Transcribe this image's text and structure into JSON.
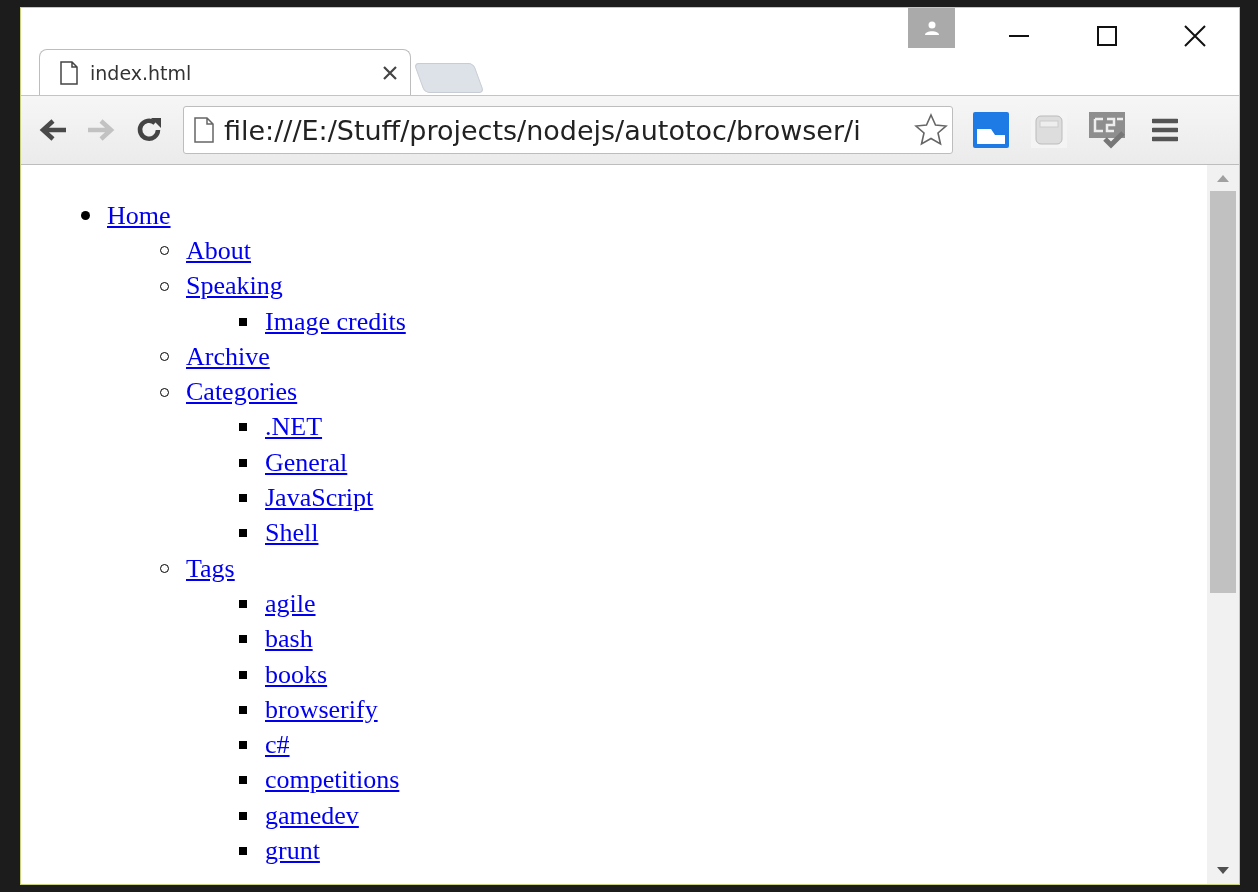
{
  "tab": {
    "title": "index.html"
  },
  "toolbar": {
    "back_disabled": false,
    "forward_disabled": true,
    "address": "file:///E:/Stuff/projects/nodejs/autotoc/browser/i"
  },
  "toc": [
    {
      "label": "Home",
      "children": [
        {
          "label": "About"
        },
        {
          "label": "Speaking",
          "children": [
            {
              "label": "Image credits"
            }
          ]
        },
        {
          "label": "Archive"
        },
        {
          "label": "Categories",
          "children": [
            {
              "label": ".NET"
            },
            {
              "label": "General"
            },
            {
              "label": "JavaScript"
            },
            {
              "label": "Shell"
            }
          ]
        },
        {
          "label": "Tags",
          "children": [
            {
              "label": "agile"
            },
            {
              "label": "bash"
            },
            {
              "label": "books"
            },
            {
              "label": "browserify"
            },
            {
              "label": "c#"
            },
            {
              "label": "competitions"
            },
            {
              "label": "gamedev"
            },
            {
              "label": "grunt"
            }
          ]
        }
      ]
    }
  ]
}
